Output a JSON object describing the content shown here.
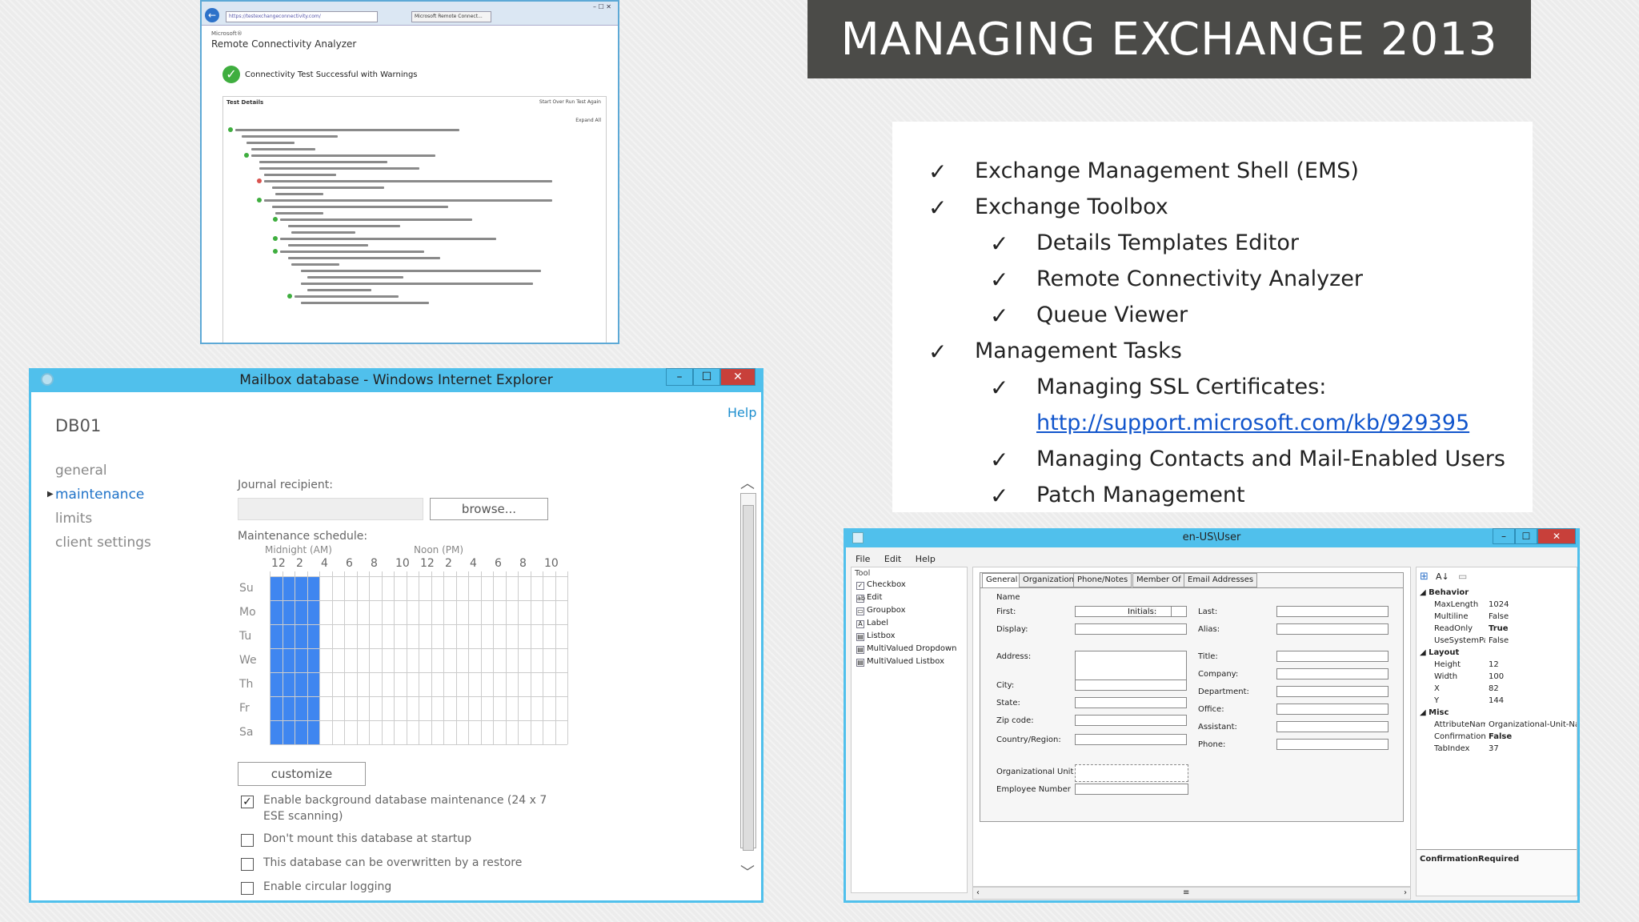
{
  "slide": {
    "title": "MANAGING EXCHANGE 2013",
    "check_glyph": "✓",
    "bullets": [
      {
        "text": "Exchange Management Shell (EMS)",
        "level": 1
      },
      {
        "text": "Exchange Toolbox",
        "level": 1
      },
      {
        "text": "Details Templates Editor",
        "level": 2
      },
      {
        "text": "Remote Connectivity Analyzer",
        "level": 2
      },
      {
        "text": "Queue Viewer",
        "level": 2
      },
      {
        "text": "Management Tasks",
        "level": 1
      },
      {
        "text": "Managing SSL Certificates:",
        "level": 2
      },
      {
        "text": "http://support.microsoft.com/kb/929395",
        "level": 2,
        "link": true
      },
      {
        "text": "Managing Contacts and Mail-Enabled Users",
        "level": 2
      },
      {
        "text": "Patch Management",
        "level": 2
      }
    ]
  },
  "rca": {
    "address": "https://testexchangeconnectivity.com/",
    "tab": "Microsoft Remote Connect...",
    "window_controls": "– ☐ ✕",
    "brand": "Microsoft®",
    "app_name": "Remote Connectivity Analyzer",
    "status": "Connectivity Test Successful with Warnings",
    "details_header": "Test Details",
    "toolbar": "Start Over   Run Test Again",
    "expand": "Expand All",
    "status_colors": {
      "success": "#3fae3f",
      "error": "#d9534f"
    }
  },
  "mailbox_window": {
    "title": "Mailbox database - Windows Internet Explorer",
    "help": "Help",
    "db_name": "DB01",
    "nav": [
      "general",
      "maintenance",
      "limits",
      "client settings"
    ],
    "nav_selected": "maintenance",
    "journal_label": "Journal recipient:",
    "journal_value": "",
    "browse": "browse...",
    "schedule_label": "Maintenance schedule:",
    "am_label": "Midnight (AM)",
    "pm_label": "Noon (PM)",
    "hours": [
      "12",
      "2",
      "4",
      "6",
      "8",
      "10",
      "12",
      "2",
      "4",
      "6",
      "8",
      "10"
    ],
    "days": [
      "Su",
      "Mo",
      "Tu",
      "We",
      "Th",
      "Fr",
      "Sa"
    ],
    "scheduled_hours_start": 0,
    "scheduled_hours_end": 4,
    "schedule_color": "#3f86f0",
    "customize": "customize",
    "options": [
      {
        "label": "Enable background database maintenance (24 x 7",
        "label2": "ESE scanning)",
        "checked": true
      },
      {
        "label": "Don't mount this database at startup",
        "checked": false
      },
      {
        "label": "This database can be overwritten by a restore",
        "checked": false
      },
      {
        "label": "Enable circular logging",
        "checked": false
      }
    ]
  },
  "user_window": {
    "title": "en-US\\User",
    "menu": [
      "File",
      "Edit",
      "Help"
    ],
    "tool_header": "Tool",
    "tools": [
      "Checkbox",
      "Edit",
      "Groupbox",
      "Label",
      "Listbox",
      "MultiValued Dropdown",
      "MultiValued Listbox"
    ],
    "tabs": [
      "General",
      "Organization",
      "Phone/Notes",
      "Member Of",
      "Email Addresses"
    ],
    "name_label": "Name",
    "fields_left": [
      "First:",
      "Display:",
      "Address:",
      "City:",
      "State:",
      "Zip code:",
      "Country/Region:"
    ],
    "initials": "Initials:",
    "fields_right": [
      "Last:",
      "Alias:",
      "Title:",
      "Company:",
      "Department:",
      "Office:",
      "Assistant:",
      "Phone:"
    ],
    "org_unit": "Organizational Unit",
    "employee_number": "Employee Number",
    "props": [
      {
        "section": "Behavior"
      },
      {
        "k": "MaxLength",
        "v": "1024"
      },
      {
        "k": "Multiline",
        "v": "False"
      },
      {
        "k": "ReadOnly",
        "v": "True"
      },
      {
        "k": "UseSystemPasswordChar",
        "v": "False"
      },
      {
        "section": "Layout"
      },
      {
        "k": "Height",
        "v": "12"
      },
      {
        "k": "Width",
        "v": "100"
      },
      {
        "k": "X",
        "v": "82"
      },
      {
        "k": "Y",
        "v": "144"
      },
      {
        "section": "Misc"
      },
      {
        "k": "AttributeName",
        "v": "Organizational-Unit-Name"
      },
      {
        "k": "ConfirmationRequired",
        "v": "False"
      },
      {
        "k": "TabIndex",
        "v": "37"
      }
    ],
    "prop_footer": "ConfirmationRequired"
  }
}
